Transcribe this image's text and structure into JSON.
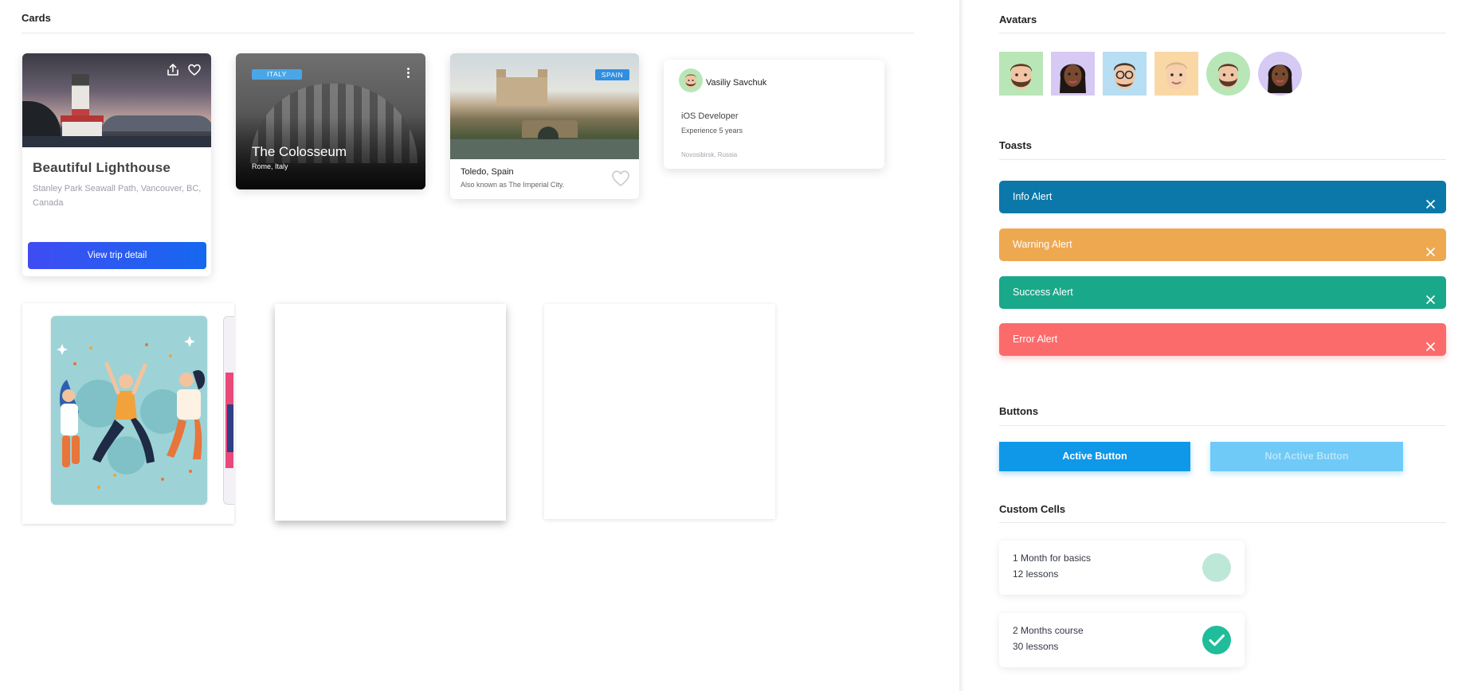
{
  "cards_section": {
    "title": "Cards",
    "lighthouse": {
      "title": "Beautiful Lighthouse",
      "subtitle": "Stanley Park Seawall Path, Vancouver, BC, Canada",
      "button_label": "View trip detail",
      "icons": [
        "share-icon",
        "heart-icon"
      ]
    },
    "colosseum": {
      "badge": "ITALY",
      "title": "The Colosseum",
      "subtitle": "Rome, Italy",
      "icons": [
        "more-vertical-icon"
      ]
    },
    "toledo": {
      "badge": "SPAIN",
      "title": "Toledo, Spain",
      "subtitle": "Also known as The Imperial City.",
      "icons": [
        "heart-outline-icon"
      ]
    },
    "profile": {
      "name": "Vasiliy Savchuk",
      "role": "iOS Developer",
      "experience": "Experience 5 years",
      "location": "Novosibirsk, Russia"
    }
  },
  "avatars_section": {
    "title": "Avatars",
    "avatars": [
      {
        "shape": "square",
        "bg": "#b9e6b7"
      },
      {
        "shape": "square",
        "bg": "#d6c9f4"
      },
      {
        "shape": "square",
        "bg": "#b7def3"
      },
      {
        "shape": "square",
        "bg": "#fad8a6"
      },
      {
        "shape": "circle",
        "bg": "#b9e6b7"
      },
      {
        "shape": "circle",
        "bg": "#d6c9f4"
      }
    ]
  },
  "toasts_section": {
    "title": "Toasts",
    "toasts": [
      {
        "label": "Info Alert",
        "color": "#0b78a9"
      },
      {
        "label": "Warning Alert",
        "color": "#eea850"
      },
      {
        "label": "Success Alert",
        "color": "#1aa88a"
      },
      {
        "label": "Error Alert",
        "color": "#fb6b6b"
      }
    ]
  },
  "buttons_section": {
    "title": "Buttons",
    "active_label": "Active Button",
    "inactive_label": "Not Active Button",
    "active_color": "#0f98e8",
    "inactive_color": "#6fcaf7"
  },
  "cells_section": {
    "title": "Custom Cells",
    "cells": [
      {
        "line1": "1 Month for basics",
        "line2": "12 lessons",
        "checked": false
      },
      {
        "line1": "2 Months course",
        "line2": "30 lessons",
        "checked": true
      }
    ]
  }
}
